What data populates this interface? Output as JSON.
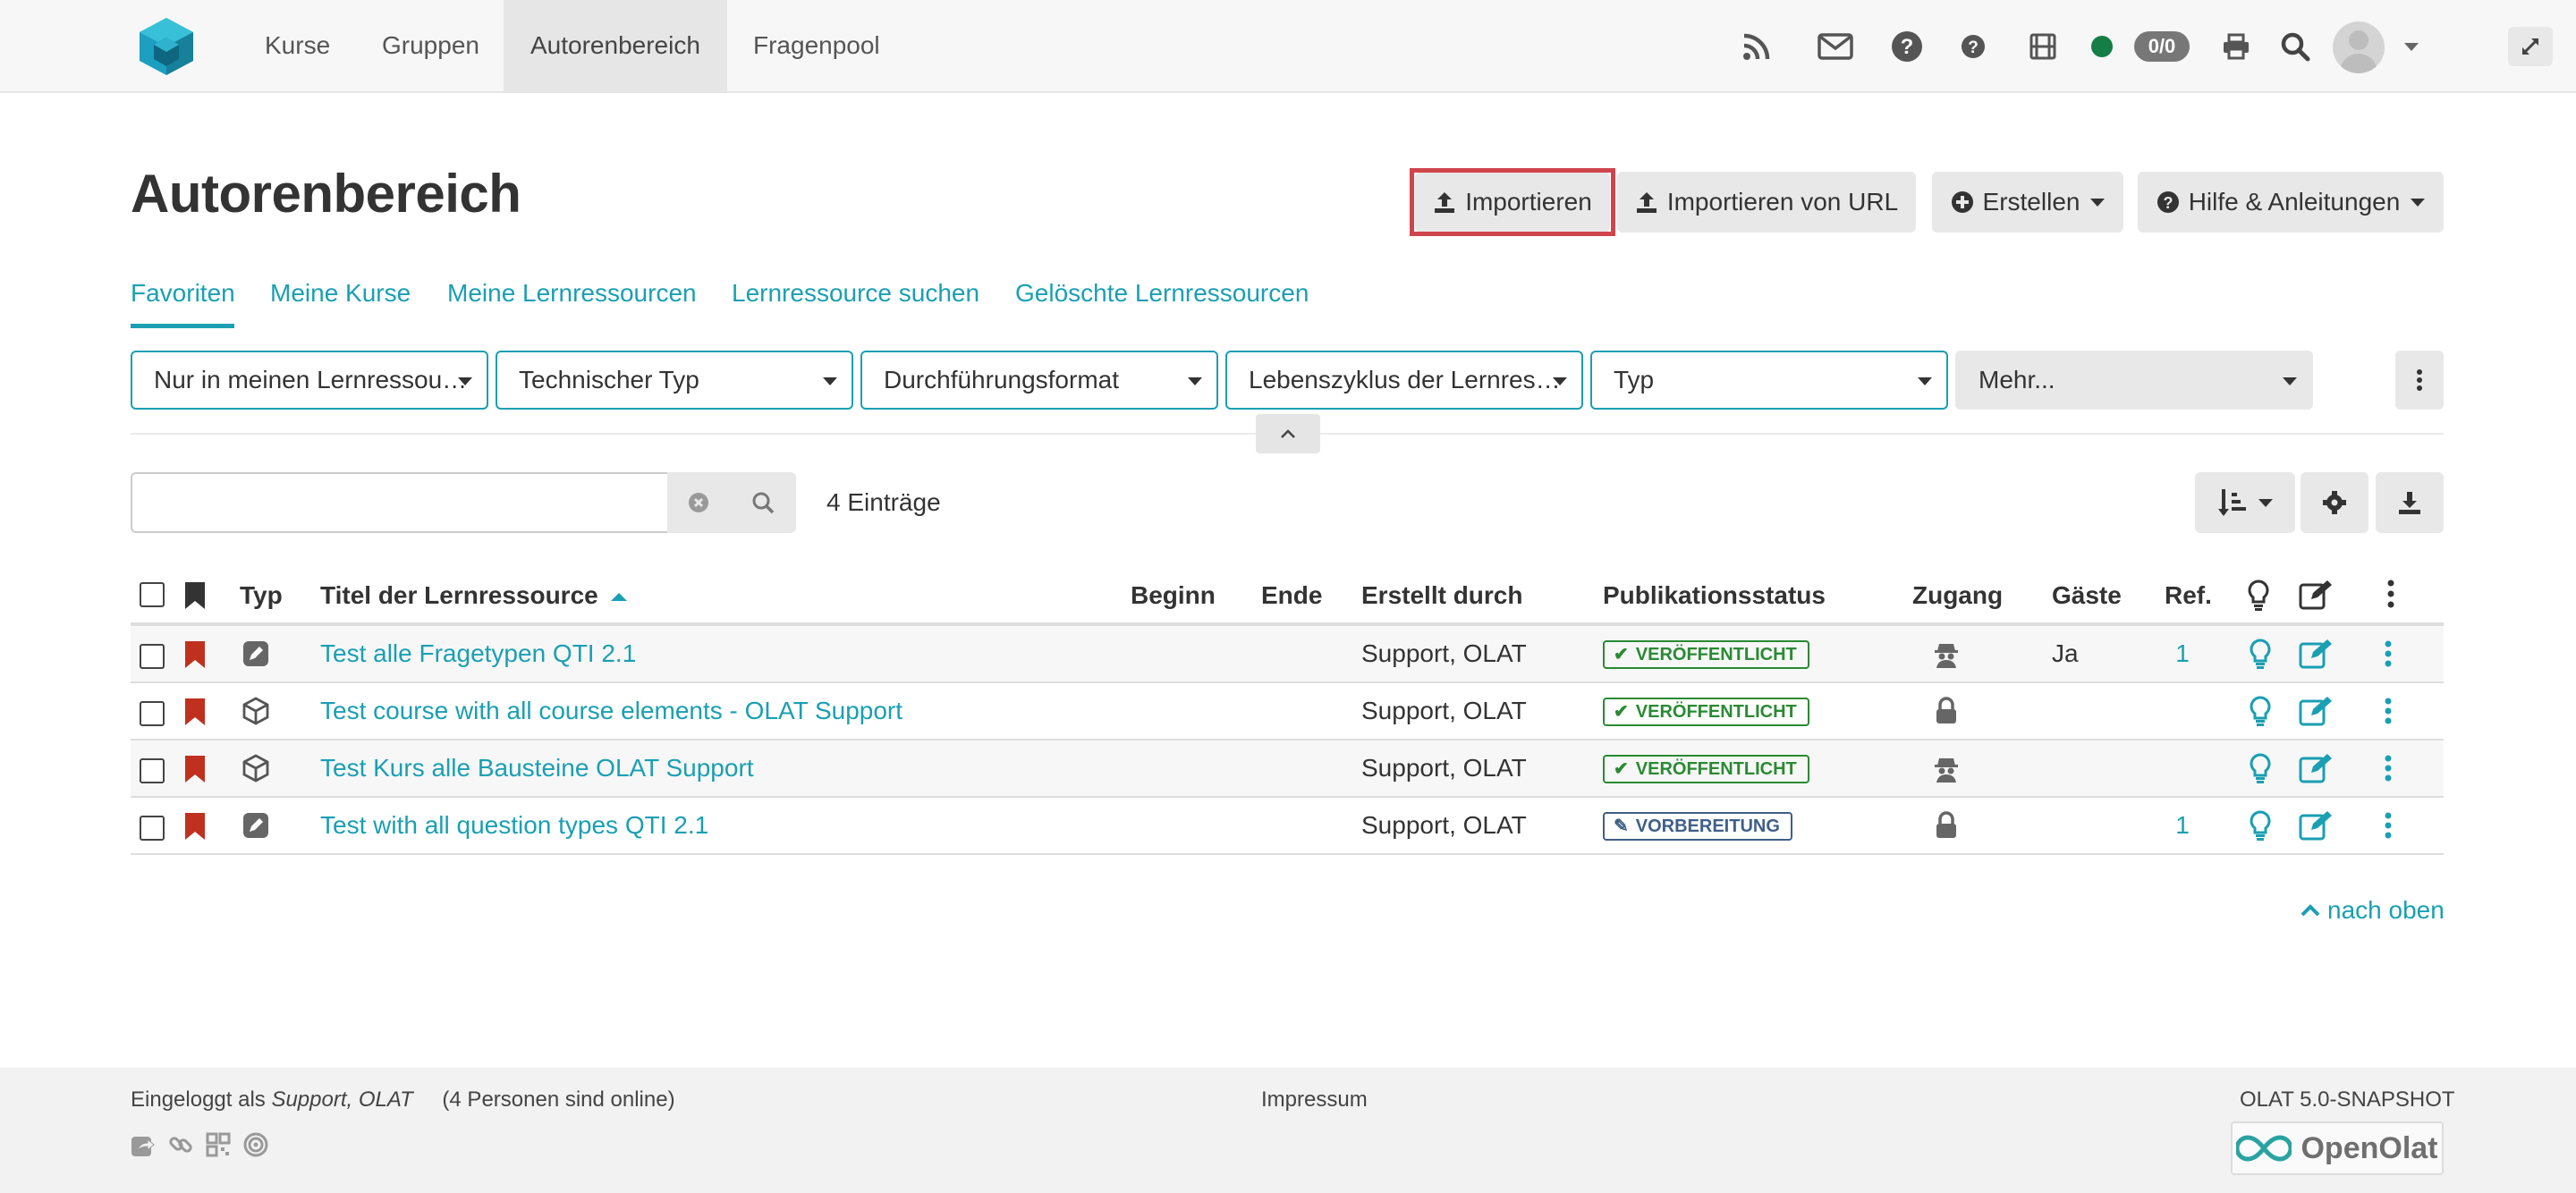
{
  "nav": {
    "items": [
      {
        "label": "Kurse"
      },
      {
        "label": "Gruppen"
      },
      {
        "label": "Autorenbereich"
      },
      {
        "label": "Fragenpool"
      }
    ],
    "active_index": 2,
    "online_count": "0/0"
  },
  "header": {
    "title": "Autorenbereich",
    "buttons": {
      "import": "Importieren",
      "import_url": "Importieren von URL",
      "create": "Erstellen",
      "help": "Hilfe & Anleitungen"
    }
  },
  "tabs": [
    {
      "label": "Favoriten"
    },
    {
      "label": "Meine Kurse"
    },
    {
      "label": "Meine Lernressourcen"
    },
    {
      "label": "Lernressource suchen"
    },
    {
      "label": "Gelöschte Lernressourcen"
    }
  ],
  "active_tab": "Favoriten",
  "filters": [
    {
      "label": "Nur in meinen Lernressou…"
    },
    {
      "label": "Technischer Typ"
    },
    {
      "label": "Durchführungsformat"
    },
    {
      "label": "Lebenszyklus der Lernres…"
    },
    {
      "label": "Typ"
    },
    {
      "label": "Mehr..."
    }
  ],
  "search": {
    "value": "",
    "entries": "4 Einträge"
  },
  "table": {
    "headers": {
      "type": "Typ",
      "title": "Titel der Lernressource",
      "begin": "Beginn",
      "end": "Ende",
      "created_by": "Erstellt durch",
      "status": "Publikationsstatus",
      "access": "Zugang",
      "guests": "Gäste",
      "ref": "Ref."
    },
    "rows": [
      {
        "type_icon": "test-icon",
        "title": "Test alle Fragetypen QTI 2.1",
        "created_by": "Support, OLAT",
        "status": "VERÖFFENTLICHT",
        "access_icon": "guest-icon",
        "guests": "Ja",
        "ref": "1"
      },
      {
        "type_icon": "course-icon",
        "title": "Test course with all course elements - OLAT Support",
        "created_by": "Support, OLAT",
        "status": "VERÖFFENTLICHT",
        "access_icon": "lock-icon",
        "guests": "",
        "ref": ""
      },
      {
        "type_icon": "course-icon",
        "title": "Test Kurs alle Bausteine OLAT Support",
        "created_by": "Support, OLAT",
        "status": "VERÖFFENTLICHT",
        "access_icon": "guest-icon",
        "guests": "",
        "ref": ""
      },
      {
        "type_icon": "test-icon",
        "title": "Test with all question types QTI 2.1",
        "created_by": "Support, OLAT",
        "status": "VORBEREITUNG",
        "access_icon": "lock-icon",
        "guests": "",
        "ref": "1"
      }
    ]
  },
  "to_top": "nach oben",
  "footer": {
    "logged_in_prefix": "Eingeloggt als",
    "logged_in_user": "Support, OLAT",
    "online": "(4 Personen sind online)",
    "impressum": "Impressum",
    "version": "OLAT 5.0-SNAPSHOT",
    "brand": "OpenOlat"
  },
  "colors": {
    "accent": "#1a9fb3",
    "highlight": "#d0454d",
    "published": "#2a8a33",
    "preparation": "#3f5f87",
    "bookmark": "#c0301e",
    "online": "#157d46"
  }
}
